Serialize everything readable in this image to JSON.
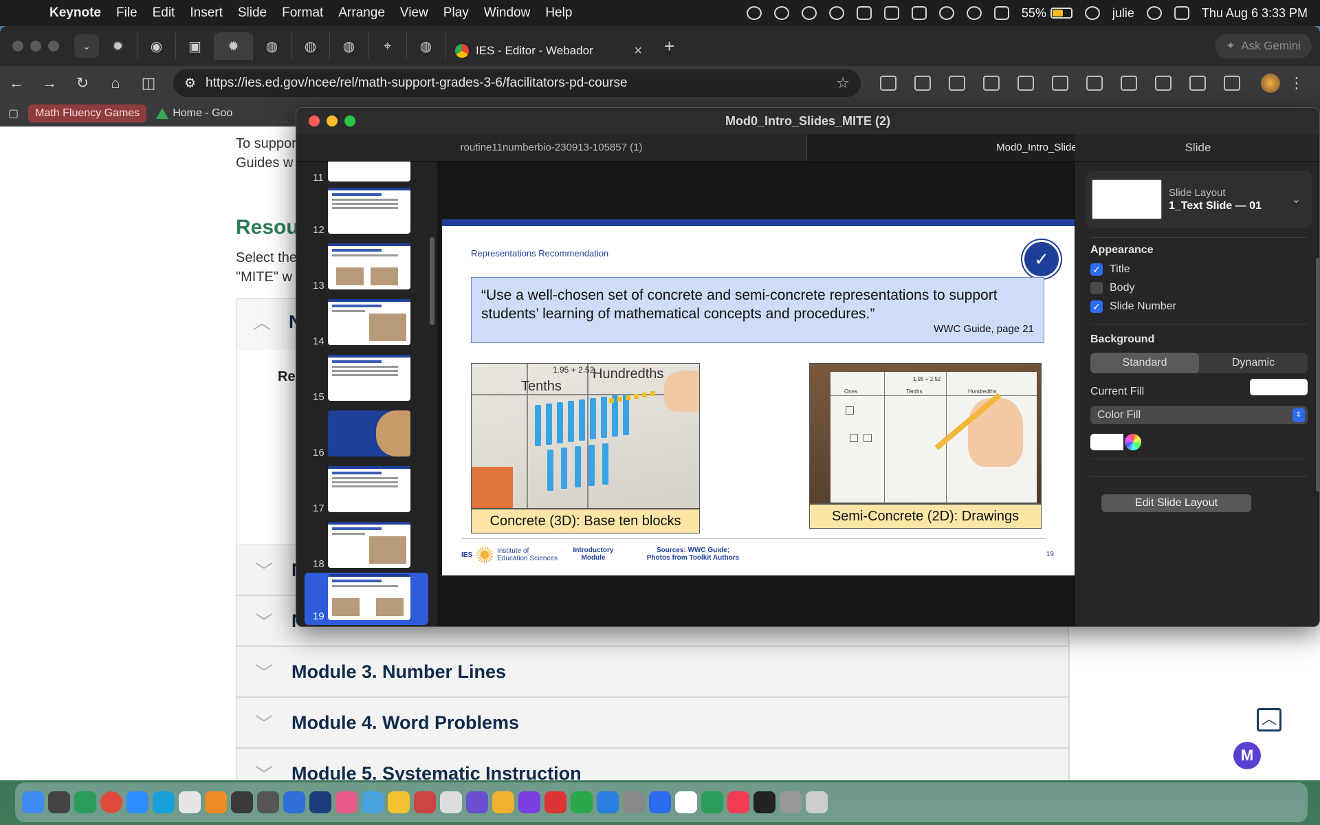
{
  "menubar": {
    "app_name": "Keynote",
    "menus": [
      "File",
      "Edit",
      "Insert",
      "Slide",
      "Format",
      "Arrange",
      "View",
      "Play",
      "Window",
      "Help"
    ],
    "battery_percent": "55%",
    "battery_level": 0.55,
    "user": "julie",
    "datetime": "Thu Aug 6  3:33 PM"
  },
  "browser": {
    "active_tab_title": "IES - Editor - Webador",
    "gemini_label": "Ask Gemini",
    "url": "https://ies.ed.gov/ncee/rel/math-support-grades-3-6/facilitators-pd-course",
    "bookmarks": [
      "Math Fluency Games",
      "Home - Goo"
    ]
  },
  "webpage": {
    "line1": "To suppor",
    "line2": "Guides w",
    "heading": "Resou",
    "select_line1": "Select the",
    "select_line2": "\"MITE\" w",
    "acc_open_letter": "N",
    "acc_open_sub": "Re",
    "acc_letter_a": "N",
    "acc_letter_b": "N",
    "modules": [
      "Module 3. Number Lines",
      "Module 4. Word Problems",
      "Module 5. Systematic Instruction"
    ],
    "m_button": "M"
  },
  "keynote": {
    "window_title": "Mod0_Intro_Slides_MITE (2)",
    "tabs": [
      "routine11numberbio-230913-105857 (1)",
      "Mod0_Intro_Slides_MITE (2)"
    ],
    "slide_numbers": [
      "11",
      "12",
      "13",
      "14",
      "15",
      "16",
      "17",
      "18",
      "19"
    ],
    "selected_slide": "19",
    "slide": {
      "kicker": "Representations Recommendation",
      "quote": "“Use a well-chosen set of concrete and semi-concrete representations to support students’ learning of mathematical concepts and procedures.”",
      "quote_source": "WWC Guide, page 21",
      "caption_left": "Concrete (3D): Base ten blocks",
      "caption_right": "Semi-Concrete (2D): Drawings",
      "photo_left_labels": [
        "1.95 + 2.52",
        "Tenths",
        "Hundredths"
      ],
      "photo_right_labels": [
        "1.95 + 2.52",
        "Ones",
        "Tenths",
        "Hundredths"
      ],
      "footer_org_line1": "Institute of",
      "footer_org_line2": "Education Sciences",
      "footer_org_short": "IES",
      "footer_module_line1": "Introductory",
      "footer_module_line2": "Module",
      "footer_sources_line1": "Sources: WWC Guide;",
      "footer_sources_line2": "Photos from Toolkit Authors",
      "page_number": "19"
    },
    "inspector": {
      "header": "Slide",
      "layout_label": "Slide Layout",
      "layout_value": "1_Text Slide — 01",
      "appearance": "Appearance",
      "options": [
        {
          "label": "Title",
          "checked": true
        },
        {
          "label": "Body",
          "checked": false
        },
        {
          "label": "Slide Number",
          "checked": true
        }
      ],
      "background": "Background",
      "bg_modes": [
        "Standard",
        "Dynamic"
      ],
      "bg_selected": "Standard",
      "current_fill": "Current Fill",
      "fill_type": "Color Fill",
      "edit_layout": "Edit Slide Layout"
    }
  },
  "colors": {
    "ies_blue": "#1f3f98",
    "caption_yellow": "#fbe6a8",
    "quote_fill": "#cfdcf7",
    "selection_blue": "#2d5bd9"
  }
}
